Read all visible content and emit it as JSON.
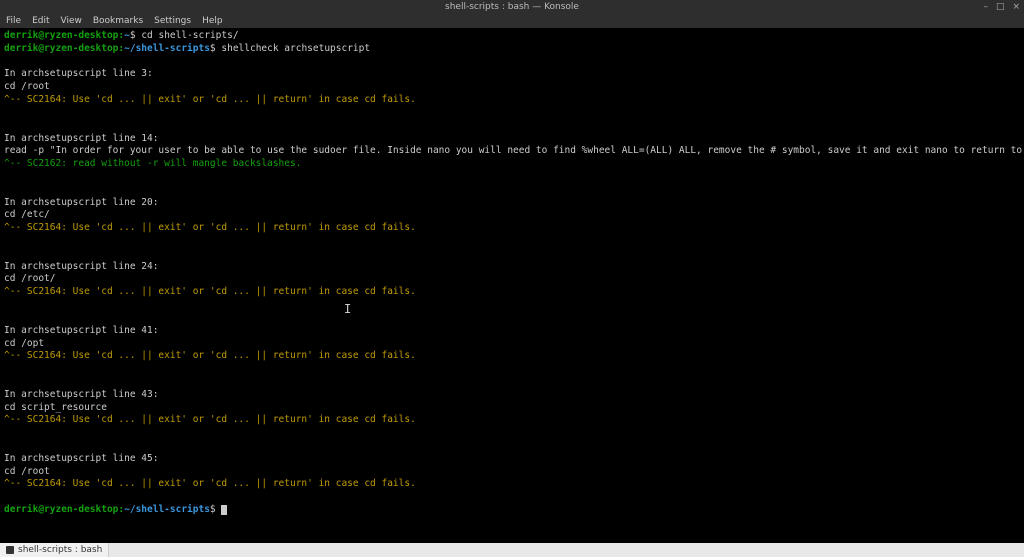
{
  "window": {
    "title": "shell-scripts : bash — Konsole",
    "controls": {
      "min": "–",
      "max": "□",
      "close": "×"
    }
  },
  "menubar": [
    "File",
    "Edit",
    "View",
    "Bookmarks",
    "Settings",
    "Help"
  ],
  "prompt1": {
    "user": "derrik@ryzen-desktop",
    "path": "~",
    "cmd": "cd shell-scripts/"
  },
  "prompt2": {
    "user": "derrik@ryzen-desktop",
    "path": "~/shell-scripts",
    "cmd": "shellcheck archsetupscript"
  },
  "blocks": [
    {
      "header": "In archsetupscript line 3:",
      "code": "cd /root",
      "note": "^-- SC2164: Use 'cd ... || exit' or 'cd ... || return' in case cd fails."
    },
    {
      "header": "In archsetupscript line 14:",
      "code": "read -p \"In order for your user to be able to use the sudoer file. Inside nano you will need to find %wheel ALL=(ALL) ALL, remove the # symbol, save it and exit nano to return to the script.\"",
      "note": "^-- SC2162: read without -r will mangle backslashes."
    },
    {
      "header": "In archsetupscript line 20:",
      "code": "cd /etc/",
      "note": "^-- SC2164: Use 'cd ... || exit' or 'cd ... || return' in case cd fails."
    },
    {
      "header": "In archsetupscript line 24:",
      "code": "cd /root/",
      "note": "^-- SC2164: Use 'cd ... || exit' or 'cd ... || return' in case cd fails."
    },
    {
      "header": "In archsetupscript line 41:",
      "code": "cd /opt",
      "note": "^-- SC2164: Use 'cd ... || exit' or 'cd ... || return' in case cd fails."
    },
    {
      "header": "In archsetupscript line 43:",
      "code": "cd script_resource",
      "note": "^-- SC2164: Use 'cd ... || exit' or 'cd ... || return' in case cd fails."
    },
    {
      "header": "In archsetupscript line 45:",
      "code": "cd /root",
      "note": "^-- SC2164: Use 'cd ... || exit' or 'cd ... || return' in case cd fails."
    }
  ],
  "prompt3": {
    "user": "derrik@ryzen-desktop",
    "path": "~/shell-scripts"
  },
  "taskbar": {
    "item": "shell-scripts : bash"
  }
}
